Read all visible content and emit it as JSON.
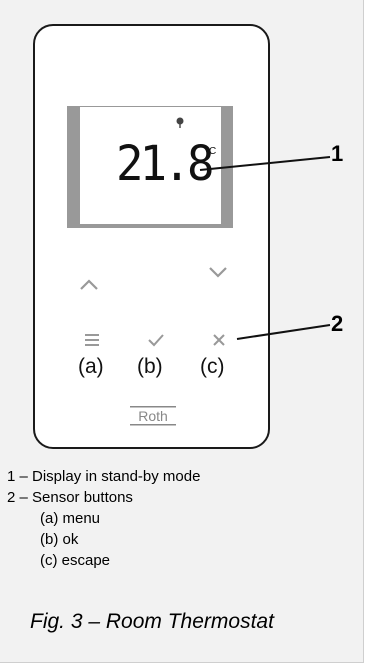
{
  "display": {
    "temperature": "21.8",
    "unit": "°C"
  },
  "callouts": {
    "one": "1",
    "two": "2"
  },
  "buttons": {
    "menu_label": "(a)",
    "ok_label": "(b)",
    "escape_label": "(c)"
  },
  "brand": "Roth",
  "legend": {
    "line1": "1 – Display in stand-by mode",
    "line2": "2 – Sensor buttons",
    "item_a": "(a) menu",
    "item_b": "(b) ok",
    "item_c": "(c) escape"
  },
  "caption": "Fig. 3 – Room Thermostat",
  "icons": [
    "signal-icon",
    "up-arrow-icon",
    "down-arrow-icon",
    "menu-icon",
    "check-icon",
    "close-icon",
    "roth-logo"
  ]
}
